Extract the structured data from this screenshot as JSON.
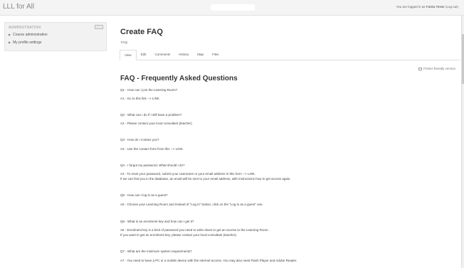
{
  "header": {
    "site_title": "LLL for All",
    "login_prefix": "You are logged in as",
    "user_name": "Fanka Tester",
    "logout_label": "(Log out)"
  },
  "admin": {
    "title": "ADMINISTRATION",
    "items": [
      "Course administration",
      "My profile settings"
    ]
  },
  "page": {
    "title": "Create FAQ",
    "breadcrumb": "FAQ",
    "tabs": [
      "View",
      "Edit",
      "Comments",
      "History",
      "Map",
      "Files"
    ],
    "active_tab": "View",
    "printer_label": "Printer-friendly version"
  },
  "faq": {
    "title": "FAQ - Frequently Asked Questions",
    "lines": [
      "Q1 - How can I join the Learning Room?",
      "A1 - Go to this link --> LINK",
      "Q2 - What can I do if I still have a problem?",
      "A2 - Please contact your local consultant (teacher).",
      "Q3 - How do I contact you?",
      "A3 - Use the contact form from this --> LINK.",
      "Q4 - I forgot my password. What should I do?",
      "A4 - To reset your password, submit your username or your email address in this form --> LINK.",
      "If we can find you in the database, an email will be sent to your email address, with instructions how to get access again.",
      "Q5 - How can I log in as a guest?",
      "A5 - Choose your Learning Room and instead of \"Log in\" button, click on the \"Log in as a guest\" one.",
      "Q6 - What is an enrolment key and how can I get it?",
      "A6 - Enrolment key is a kind of password you need to write down to get an access to the Learning Room.",
      "If you want to get an enrolment key, please contact your local consultant (teacher).",
      "Q7 - What are the minimum system requirements?",
      "A7 - You need to have a PC or a mobile device with the Internet access. You may also need Flash Player and Adobe Reader."
    ]
  }
}
